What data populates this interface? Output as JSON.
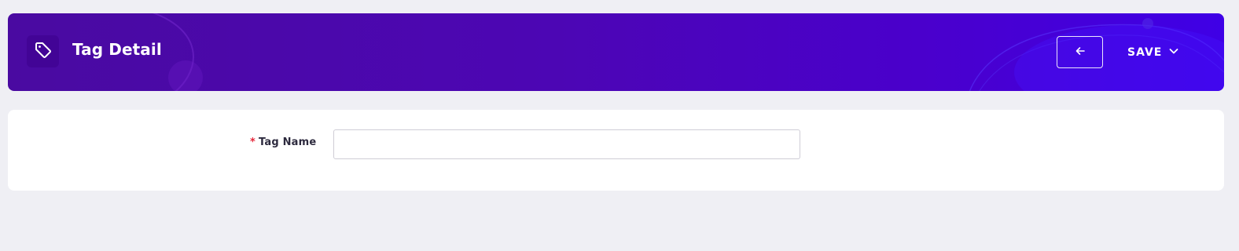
{
  "header": {
    "title": "Tag Detail",
    "title_icon": "tag-icon",
    "back_icon": "arrow-left-icon",
    "save_label": "SAVE",
    "save_icon": "chevron-down-icon"
  },
  "form": {
    "fields": [
      {
        "label": "Tag Name",
        "required_marker": "*",
        "value": "",
        "placeholder": ""
      }
    ]
  },
  "colors": {
    "page_background": "#efeff4",
    "header_gradient_start": "#4a0aa1",
    "header_gradient_end": "#3f00e6",
    "required": "#e5283b",
    "card_background": "#ffffff"
  }
}
